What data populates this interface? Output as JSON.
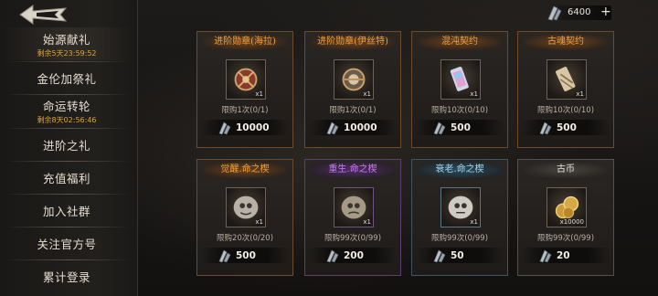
{
  "sidebar": {
    "items": [
      {
        "label": "始源献礼",
        "timer": "剩余5天23:59:52"
      },
      {
        "label": "金伦加祭礼",
        "timer": ""
      },
      {
        "label": "命运转轮",
        "timer": "剩余8天02:56:46"
      },
      {
        "label": "进阶之礼",
        "timer": ""
      },
      {
        "label": "充值福利",
        "timer": ""
      },
      {
        "label": "加入社群",
        "timer": ""
      },
      {
        "label": "关注官方号",
        "timer": ""
      },
      {
        "label": "累计登录",
        "timer": ""
      }
    ]
  },
  "currency": {
    "amount": "6400",
    "plus": "+"
  },
  "shop": {
    "cards": [
      {
        "title": "进阶勋章(海拉)",
        "qty": "x1",
        "limit": "限购1次(0/1)",
        "price": "10000",
        "rarity": "orange",
        "icon": "medal-hela-icon"
      },
      {
        "title": "进阶勋章(伊丝特)",
        "qty": "x1",
        "limit": "限购1次(0/1)",
        "price": "10000",
        "rarity": "orange",
        "icon": "medal-ishtar-icon"
      },
      {
        "title": "混沌契约",
        "qty": "x1",
        "limit": "限购10次(0/10)",
        "price": "500",
        "rarity": "orange",
        "icon": "chaos-contract-icon"
      },
      {
        "title": "古魂契约",
        "qty": "x1",
        "limit": "限购10次(0/10)",
        "price": "500",
        "rarity": "orange",
        "icon": "ancient-soul-contract-icon"
      },
      {
        "title": "觉醒.命之楔",
        "qty": "x1",
        "limit": "限购20次(0/20)",
        "price": "500",
        "rarity": "orange",
        "icon": "awaken-wedge-icon"
      },
      {
        "title": "重生.命之楔",
        "qty": "x1",
        "limit": "限购99次(0/99)",
        "price": "200",
        "rarity": "purple",
        "icon": "rebirth-wedge-icon"
      },
      {
        "title": "衰老.命之楔",
        "qty": "x1",
        "limit": "限购99次(0/99)",
        "price": "50",
        "rarity": "blue",
        "icon": "decay-wedge-icon"
      },
      {
        "title": "古币",
        "qty": "x10000",
        "limit": "限购99次(0/99)",
        "price": "20",
        "rarity": "grey",
        "icon": "ancient-coin-icon"
      }
    ]
  },
  "colors": {
    "orange": "#f0a13b",
    "purple": "#c77cf0",
    "blue": "#9fd6ef",
    "grey": "#e6e2da",
    "timer": "#e0a528"
  }
}
